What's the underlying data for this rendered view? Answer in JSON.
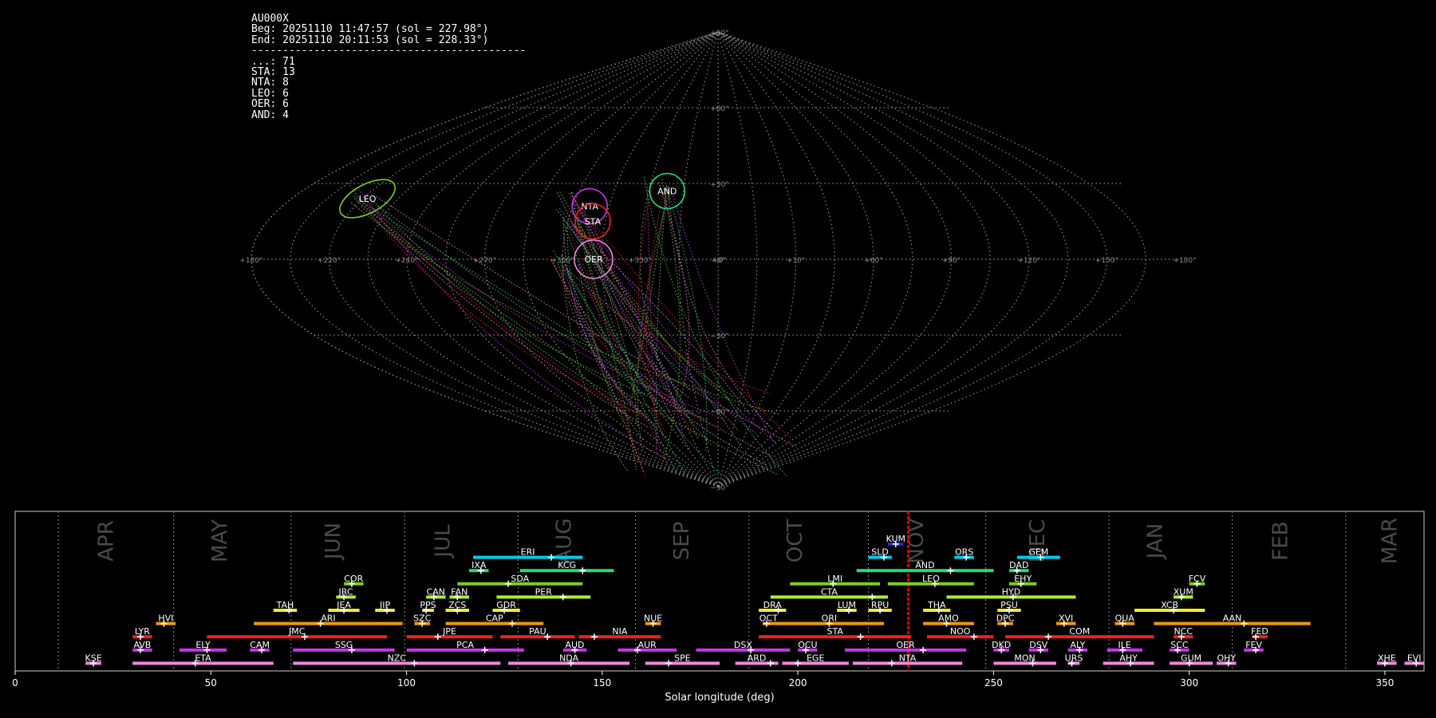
{
  "info": {
    "station": "AU000X",
    "begin": "Beg: 20251110 11:47:57 (sol = 227.98°)",
    "end": "End: 20251110 20:11:53 (sol = 228.33°)",
    "separator": "--------------------------------------------",
    "counts": [
      {
        "code": "...",
        "n": 71
      },
      {
        "code": "STA",
        "n": 13
      },
      {
        "code": "NTA",
        "n": 8
      },
      {
        "code": "LEO",
        "n": 6
      },
      {
        "code": "OER",
        "n": 6
      },
      {
        "code": "AND",
        "n": 4
      }
    ]
  },
  "chart_data": [
    {
      "type": "scatter",
      "projection": "sinusoidal",
      "title": "",
      "lon_ticks": [
        "+180°",
        "+150°",
        "+120°",
        "+90°",
        "+60°",
        "+30°",
        "+0°",
        "+330°",
        "+300°",
        "+270°",
        "+240°",
        "+210°",
        "+180°"
      ],
      "lat_ticks": [
        "+90°",
        "+60°",
        "+30°",
        "+0°",
        "−30°",
        "−60°",
        "−90°"
      ],
      "grid": true,
      "radiants": [
        {
          "name": "LEO",
          "ra": 148,
          "dec": 24,
          "color": "#7ccd1f"
        },
        {
          "name": "NTA",
          "ra": 53,
          "dec": 21,
          "color": "#cc33ee"
        },
        {
          "name": "STA",
          "ra": 50,
          "dec": 15,
          "color": "#ee2222"
        },
        {
          "name": "OER",
          "ra": 48,
          "dec": 0,
          "color": "#ee88dd"
        },
        {
          "name": "AND",
          "ra": 22,
          "dec": 27,
          "color": "#22dd77"
        }
      ]
    },
    {
      "type": "bar",
      "orientation": "horizontal",
      "xlabel": "Solar longitude (deg)",
      "xlim": [
        0,
        360
      ],
      "x_ticks": [
        0,
        50,
        100,
        150,
        200,
        250,
        300,
        350
      ],
      "current_sol": 228.2,
      "months": [
        {
          "label": "APR",
          "start": 11,
          "mid": 25
        },
        {
          "label": "MAY",
          "start": 40.5,
          "mid": 54
        },
        {
          "label": "JUN",
          "start": 70.5,
          "mid": 83
        },
        {
          "label": "JUL",
          "start": 99.5,
          "mid": 111
        },
        {
          "label": "AUG",
          "start": 128.5,
          "mid": 142
        },
        {
          "label": "SEP",
          "start": 158.5,
          "mid": 172
        },
        {
          "label": "OCT",
          "start": 187.5,
          "mid": 201
        },
        {
          "label": "NOV",
          "start": 218,
          "mid": 232
        },
        {
          "label": "DEC",
          "start": 248,
          "mid": 263
        },
        {
          "label": "JAN",
          "start": 279.5,
          "mid": 293
        },
        {
          "label": "FEB",
          "start": 311,
          "mid": 325
        },
        {
          "label": "MAR",
          "start": 340,
          "mid": 353
        }
      ],
      "showers": [
        {
          "code": "KUM",
          "start": 223,
          "end": 227,
          "peak": 225,
          "row": 0,
          "color": "#1a2ecc"
        },
        {
          "code": "ERI",
          "start": 117,
          "end": 145,
          "peak": 137,
          "row": 1,
          "color": "#00ccee"
        },
        {
          "code": "SLD",
          "start": 218,
          "end": 224,
          "peak": 222,
          "row": 1,
          "color": "#00ccee"
        },
        {
          "code": "ORS",
          "start": 240,
          "end": 245,
          "peak": 243,
          "row": 1,
          "color": "#00ccee"
        },
        {
          "code": "GEM",
          "start": 256,
          "end": 267,
          "peak": 262,
          "row": 1,
          "color": "#00ccee"
        },
        {
          "code": "IXA",
          "start": 116,
          "end": 121,
          "peak": 119,
          "row": 2,
          "color": "#22dd77"
        },
        {
          "code": "KCG",
          "start": 129,
          "end": 153,
          "peak": 145,
          "row": 2,
          "color": "#22dd77"
        },
        {
          "code": "AND",
          "start": 215,
          "end": 250,
          "peak": 239,
          "row": 2,
          "color": "#22dd77"
        },
        {
          "code": "DAD",
          "start": 254,
          "end": 259,
          "peak": 256,
          "row": 2,
          "color": "#22dd77"
        },
        {
          "code": "COR",
          "start": 84,
          "end": 89,
          "peak": 86,
          "row": 3,
          "color": "#7ccd1f"
        },
        {
          "code": "SDA",
          "start": 113,
          "end": 145,
          "peak": 126,
          "row": 3,
          "color": "#7ccd1f"
        },
        {
          "code": "LMI",
          "start": 198,
          "end": 221,
          "peak": 209,
          "row": 3,
          "color": "#7ccd1f"
        },
        {
          "code": "LEO",
          "start": 223,
          "end": 245,
          "peak": 235,
          "row": 3,
          "color": "#7ccd1f"
        },
        {
          "code": "EHY",
          "start": 254,
          "end": 261,
          "peak": 257,
          "row": 3,
          "color": "#7ccd1f"
        },
        {
          "code": "FCV",
          "start": 300,
          "end": 304,
          "peak": 302,
          "row": 3,
          "color": "#7ccd1f"
        },
        {
          "code": "JRC",
          "start": 82,
          "end": 87,
          "peak": 84,
          "row": 4,
          "color": "#aaee33"
        },
        {
          "code": "CAN",
          "start": 105,
          "end": 110,
          "peak": 107,
          "row": 4,
          "color": "#aaee33"
        },
        {
          "code": "FAN",
          "start": 111,
          "end": 116,
          "peak": 113,
          "row": 4,
          "color": "#aaee33"
        },
        {
          "code": "PER",
          "start": 123,
          "end": 147,
          "peak": 140,
          "row": 4,
          "color": "#aaee33"
        },
        {
          "code": "CTA",
          "start": 193,
          "end": 223,
          "peak": 219,
          "row": 4,
          "color": "#aaee33"
        },
        {
          "code": "HYD",
          "start": 238,
          "end": 271,
          "peak": 255,
          "row": 4,
          "color": "#aaee33"
        },
        {
          "code": "XUM",
          "start": 296,
          "end": 301,
          "peak": 298,
          "row": 4,
          "color": "#aaee33"
        },
        {
          "code": "TAH",
          "start": 66,
          "end": 72,
          "peak": 70,
          "row": 5,
          "color": "#eeee22"
        },
        {
          "code": "JEA",
          "start": 80,
          "end": 88,
          "peak": 84,
          "row": 5,
          "color": "#eeee22"
        },
        {
          "code": "JIP",
          "start": 92,
          "end": 97,
          "peak": 95,
          "row": 5,
          "color": "#eeee22"
        },
        {
          "code": "PPS",
          "start": 104,
          "end": 107,
          "peak": 105,
          "row": 5,
          "color": "#eeee22"
        },
        {
          "code": "ZCS",
          "start": 110,
          "end": 116,
          "peak": 113,
          "row": 5,
          "color": "#eeee22"
        },
        {
          "code": "GDR",
          "start": 122,
          "end": 129,
          "peak": 125,
          "row": 5,
          "color": "#eeee22"
        },
        {
          "code": "DRA",
          "start": 190,
          "end": 197,
          "peak": 195,
          "row": 5,
          "color": "#eeee22"
        },
        {
          "code": "LUM",
          "start": 210,
          "end": 215,
          "peak": 213,
          "row": 5,
          "color": "#eeee22"
        },
        {
          "code": "RPU",
          "start": 218,
          "end": 224,
          "peak": 221,
          "row": 5,
          "color": "#eeee22"
        },
        {
          "code": "THA",
          "start": 232,
          "end": 239,
          "peak": 236,
          "row": 5,
          "color": "#eeee22"
        },
        {
          "code": "PSU",
          "start": 251,
          "end": 257,
          "peak": 254,
          "row": 5,
          "color": "#eeee22"
        },
        {
          "code": "XCB",
          "start": 286,
          "end": 304,
          "peak": 296,
          "row": 5,
          "color": "#eeee22"
        },
        {
          "code": "HVI",
          "start": 36,
          "end": 41,
          "peak": 38,
          "row": 6,
          "color": "#ee9911"
        },
        {
          "code": "ARI",
          "start": 61,
          "end": 99,
          "peak": 78,
          "row": 6,
          "color": "#ee9911"
        },
        {
          "code": "SZC",
          "start": 102,
          "end": 106,
          "peak": 104,
          "row": 6,
          "color": "#ee9911"
        },
        {
          "code": "CAP",
          "start": 110,
          "end": 135,
          "peak": 127,
          "row": 6,
          "color": "#ee9911"
        },
        {
          "code": "NUE",
          "start": 161,
          "end": 165,
          "peak": 163,
          "row": 6,
          "color": "#ee9911"
        },
        {
          "code": "OCT",
          "start": 191,
          "end": 194,
          "peak": 192,
          "row": 6,
          "color": "#ee9911"
        },
        {
          "code": "ORI",
          "start": 194,
          "end": 222,
          "peak": 208,
          "row": 6,
          "color": "#ee9911"
        },
        {
          "code": "AMO",
          "start": 232,
          "end": 245,
          "peak": 238,
          "row": 6,
          "color": "#ee9911"
        },
        {
          "code": "DPC",
          "start": 251,
          "end": 255,
          "peak": 253,
          "row": 6,
          "color": "#ee9911"
        },
        {
          "code": "XVI",
          "start": 266,
          "end": 271,
          "peak": 268,
          "row": 6,
          "color": "#ee9911"
        },
        {
          "code": "QUA",
          "start": 281,
          "end": 286,
          "peak": 283,
          "row": 6,
          "color": "#ee9911"
        },
        {
          "code": "AAN",
          "start": 291,
          "end": 331,
          "peak": 314,
          "row": 6,
          "color": "#ee9911"
        },
        {
          "code": "LYR",
          "start": 30,
          "end": 35,
          "peak": 32,
          "row": 7,
          "color": "#ee2222"
        },
        {
          "code": "JMC",
          "start": 49,
          "end": 95,
          "peak": 74,
          "row": 7,
          "color": "#ee2222"
        },
        {
          "code": "JPE",
          "start": 100,
          "end": 122,
          "peak": 108,
          "row": 7,
          "color": "#ee2222"
        },
        {
          "code": "PAU",
          "start": 124,
          "end": 143,
          "peak": 136,
          "row": 7,
          "color": "#ee2222"
        },
        {
          "code": "NIA",
          "start": 144,
          "end": 165,
          "peak": 148,
          "row": 7,
          "color": "#ee2222"
        },
        {
          "code": "STA",
          "start": 190,
          "end": 229,
          "peak": 216,
          "row": 7,
          "color": "#ee2222"
        },
        {
          "code": "NOO",
          "start": 233,
          "end": 250,
          "peak": 245,
          "row": 7,
          "color": "#ee2222"
        },
        {
          "code": "COM",
          "start": 253,
          "end": 291,
          "peak": 264,
          "row": 7,
          "color": "#ee2222"
        },
        {
          "code": "NCC",
          "start": 296,
          "end": 301,
          "peak": 298,
          "row": 7,
          "color": "#ee2222"
        },
        {
          "code": "FED",
          "start": 316,
          "end": 320,
          "peak": 317,
          "row": 7,
          "color": "#ee2222"
        },
        {
          "code": "AVB",
          "start": 30,
          "end": 35,
          "peak": 32,
          "row": 8,
          "color": "#cc33ee"
        },
        {
          "code": "ELY",
          "start": 42,
          "end": 54,
          "peak": 49,
          "row": 8,
          "color": "#cc33ee"
        },
        {
          "code": "CAM",
          "start": 60,
          "end": 65,
          "peak": 63,
          "row": 8,
          "color": "#cc33ee"
        },
        {
          "code": "SSG",
          "start": 71,
          "end": 97,
          "peak": 86,
          "row": 8,
          "color": "#cc33ee"
        },
        {
          "code": "PCA",
          "start": 100,
          "end": 130,
          "peak": 120,
          "row": 8,
          "color": "#cc33ee"
        },
        {
          "code": "AUD",
          "start": 140,
          "end": 146,
          "peak": 143,
          "row": 8,
          "color": "#cc33ee"
        },
        {
          "code": "AUR",
          "start": 154,
          "end": 169,
          "peak": 159,
          "row": 8,
          "color": "#cc33ee"
        },
        {
          "code": "DSX",
          "start": 174,
          "end": 198,
          "peak": 188,
          "row": 8,
          "color": "#cc33ee"
        },
        {
          "code": "OCU",
          "start": 200,
          "end": 205,
          "peak": 202,
          "row": 8,
          "color": "#cc33ee"
        },
        {
          "code": "OER",
          "start": 212,
          "end": 243,
          "peak": 232,
          "row": 8,
          "color": "#cc33ee"
        },
        {
          "code": "DKD",
          "start": 250,
          "end": 254,
          "peak": 252,
          "row": 8,
          "color": "#cc33ee"
        },
        {
          "code": "DSV",
          "start": 259,
          "end": 264,
          "peak": 262,
          "row": 8,
          "color": "#cc33ee"
        },
        {
          "code": "ALY",
          "start": 269,
          "end": 274,
          "peak": 272,
          "row": 8,
          "color": "#cc33ee"
        },
        {
          "code": "ILE",
          "start": 279,
          "end": 288,
          "peak": 283,
          "row": 8,
          "color": "#cc33ee"
        },
        {
          "code": "SCC",
          "start": 295,
          "end": 300,
          "peak": 297,
          "row": 8,
          "color": "#cc33ee"
        },
        {
          "code": "FEV",
          "start": 314,
          "end": 319,
          "peak": 317,
          "row": 8,
          "color": "#cc33ee"
        },
        {
          "code": "KSE",
          "start": 18,
          "end": 22,
          "peak": 20,
          "row": 9,
          "color": "#ee88dd"
        },
        {
          "code": "ETA",
          "start": 30,
          "end": 66,
          "peak": 46,
          "row": 9,
          "color": "#ee88dd"
        },
        {
          "code": "NZC",
          "start": 71,
          "end": 124,
          "peak": 102,
          "row": 9,
          "color": "#ee88dd"
        },
        {
          "code": "NDA",
          "start": 126,
          "end": 157,
          "peak": 142,
          "row": 9,
          "color": "#ee88dd"
        },
        {
          "code": "SPE",
          "start": 161,
          "end": 180,
          "peak": 167,
          "row": 9,
          "color": "#ee88dd"
        },
        {
          "code": "ARD",
          "start": 184,
          "end": 195,
          "peak": 193,
          "row": 9,
          "color": "#ee88dd"
        },
        {
          "code": "EGE",
          "start": 196,
          "end": 213,
          "peak": 200,
          "row": 9,
          "color": "#ee88dd"
        },
        {
          "code": "NTA",
          "start": 214,
          "end": 242,
          "peak": 224,
          "row": 9,
          "color": "#ee88dd"
        },
        {
          "code": "MON",
          "start": 250,
          "end": 266,
          "peak": 260,
          "row": 9,
          "color": "#ee88dd"
        },
        {
          "code": "URS",
          "start": 269,
          "end": 272,
          "peak": 270,
          "row": 9,
          "color": "#ee88dd"
        },
        {
          "code": "AHY",
          "start": 278,
          "end": 291,
          "peak": 285,
          "row": 9,
          "color": "#ee88dd"
        },
        {
          "code": "GUM",
          "start": 295,
          "end": 306,
          "peak": 300,
          "row": 9,
          "color": "#ee88dd"
        },
        {
          "code": "OHY",
          "start": 307,
          "end": 312,
          "peak": 310,
          "row": 9,
          "color": "#ee88dd"
        },
        {
          "code": "XHE",
          "start": 348,
          "end": 353,
          "peak": 350,
          "row": 9,
          "color": "#ee88dd"
        },
        {
          "code": "EVI",
          "start": 355,
          "end": 360,
          "peak": 358,
          "row": 9,
          "color": "#ee88dd"
        }
      ]
    }
  ]
}
